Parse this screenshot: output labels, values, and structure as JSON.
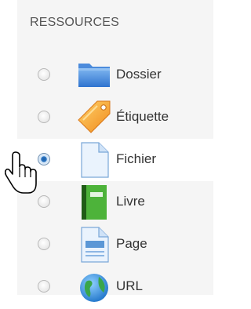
{
  "section": {
    "heading": "RESSOURCES"
  },
  "items": [
    {
      "label": "Dossier",
      "icon": "folder-icon",
      "selected": false
    },
    {
      "label": "Étiquette",
      "icon": "label-tag-icon",
      "selected": false
    },
    {
      "label": "Fichier",
      "icon": "file-icon",
      "selected": true
    },
    {
      "label": "Livre",
      "icon": "book-icon",
      "selected": false
    },
    {
      "label": "Page",
      "icon": "page-icon",
      "selected": false
    },
    {
      "label": "URL",
      "icon": "globe-icon",
      "selected": false
    }
  ],
  "colors": {
    "panel_background": "#f5f5f5",
    "selected_row_background": "#ffffff",
    "text": "#333333",
    "heading": "#555555",
    "radio_checked": "#2f78c4"
  },
  "pointer": "hand-cursor-icon"
}
